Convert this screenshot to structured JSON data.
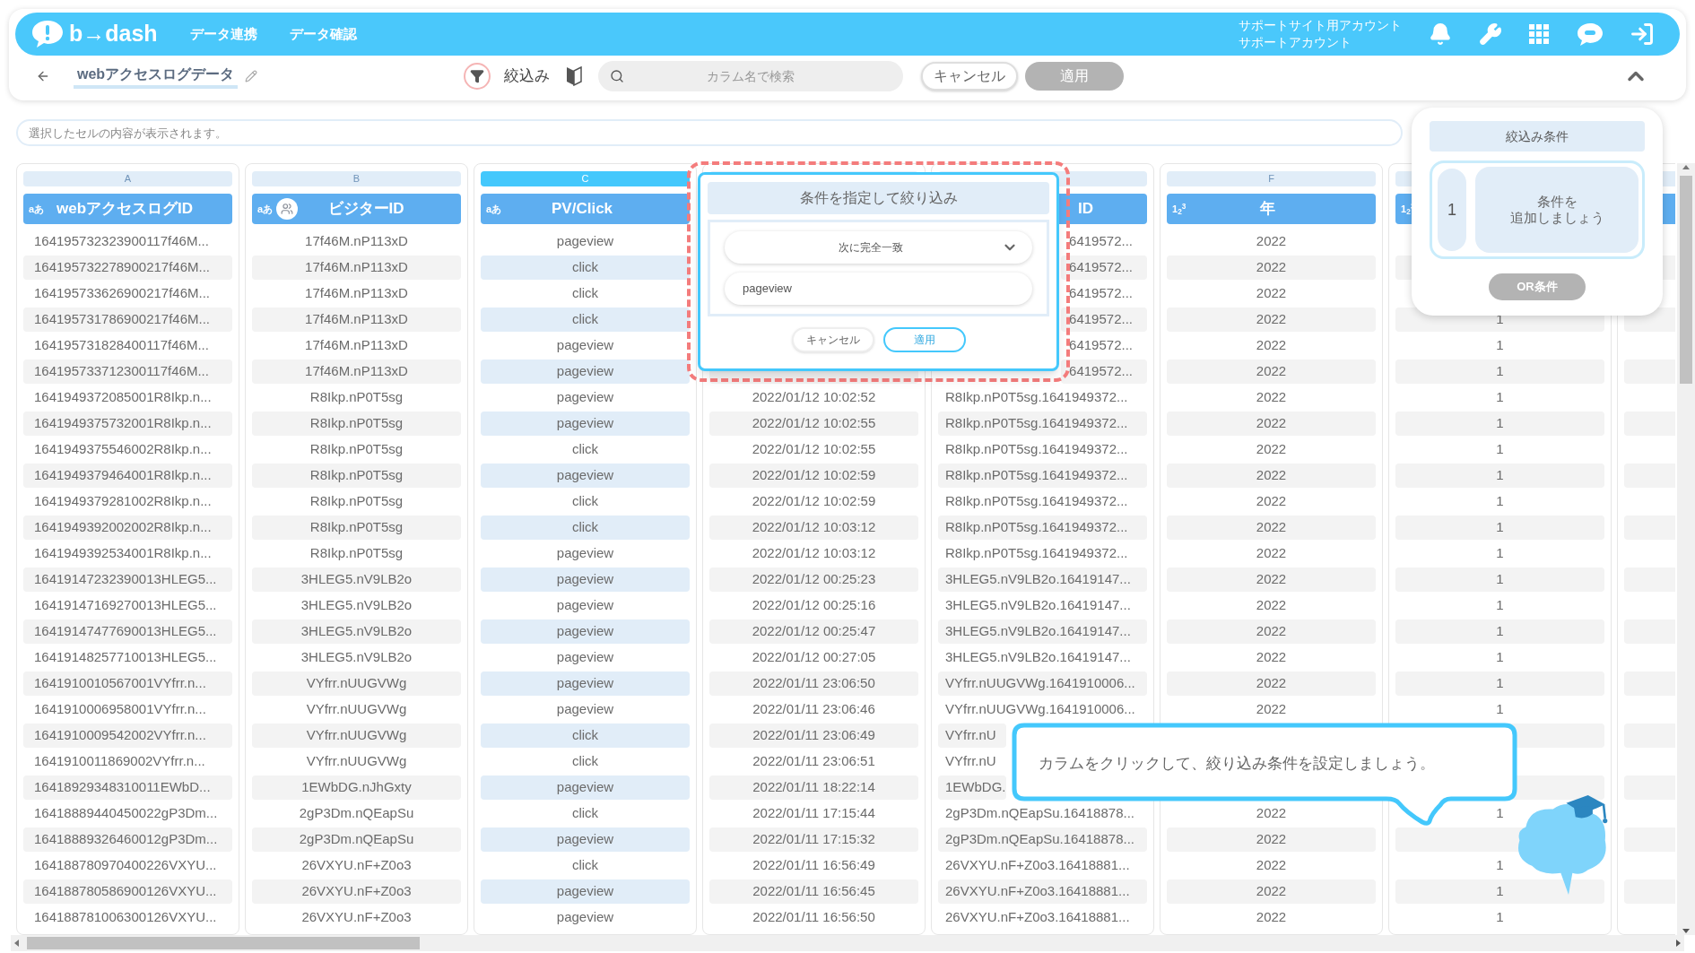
{
  "header": {
    "logo_text": "b→dash",
    "nav": [
      "データ連携",
      "データ確認"
    ],
    "account_lines": [
      "サポートサイト用アカウント",
      "サポートアカウント"
    ]
  },
  "toolbar": {
    "title": "webアクセスログデータ",
    "filter_label": "絞込み",
    "search": {
      "placeholder": "カラム名で検索"
    },
    "buttons": [
      {
        "label": "キャンセル",
        "kind": "secondary",
        "disabled": false
      },
      {
        "label": "適用",
        "kind": "primary",
        "disabled": true
      }
    ]
  },
  "formula_bar": {
    "placeholder": "選択したセルの内容が表示されます。"
  },
  "columns": [
    {
      "letter": "A",
      "type_badge": "aあ",
      "label": "webアクセスログID",
      "visitor": false,
      "selected": false,
      "cells": [
        "164195732323900117f46M...",
        "164195732278900217f46M...",
        "164195733626900217f46M...",
        "164195731786900217f46M...",
        "164195731828400117f46M...",
        "164195733712300117f46M...",
        "1641949372085001R8Ikp.n...",
        "1641949375732001R8Ikp.n...",
        "1641949375546002R8Ikp.n...",
        "1641949379464001R8Ikp.n...",
        "1641949379281002R8Ikp.n...",
        "1641949392002002R8Ikp.n...",
        "1641949392534001R8Ikp.n...",
        "16419147232390013HLEG5...",
        "16419147169270013HLEG5...",
        "16419147477690013HLEG5...",
        "16419148257710013HLEG5...",
        "1641910010567001VYfrr.n...",
        "1641910006958001VYfrr.n...",
        "1641910009542002VYfrr.n...",
        "1641910011869002VYfrr.n...",
        "16418929348310011EWbD...",
        "16418889440450022gP3Dm...",
        "16418889326460012gP3Dm...",
        "164188780970400226VXYU...",
        "164188780586900126VXYU...",
        "164188781006300126VXYU..."
      ]
    },
    {
      "letter": "B",
      "type_badge": "aあ",
      "label": "ビジターID",
      "visitor": true,
      "selected": false,
      "cells": [
        "17f46M.nP113xD",
        "17f46M.nP113xD",
        "17f46M.nP113xD",
        "17f46M.nP113xD",
        "17f46M.nP113xD",
        "17f46M.nP113xD",
        "R8Ikp.nP0T5sg",
        "R8Ikp.nP0T5sg",
        "R8Ikp.nP0T5sg",
        "R8Ikp.nP0T5sg",
        "R8Ikp.nP0T5sg",
        "R8Ikp.nP0T5sg",
        "R8Ikp.nP0T5sg",
        "3HLEG5.nV9LB2o",
        "3HLEG5.nV9LB2o",
        "3HLEG5.nV9LB2o",
        "3HLEG5.nV9LB2o",
        "VYfrr.nUUGVWg",
        "VYfrr.nUUGVWg",
        "VYfrr.nUUGVWg",
        "VYfrr.nUUGVWg",
        "1EWbDG.nJhGxty",
        "2gP3Dm.nQEapSu",
        "2gP3Dm.nQEapSu",
        "26VXYU.nF+Z0o3",
        "26VXYU.nF+Z0o3",
        "26VXYU.nF+Z0o3"
      ]
    },
    {
      "letter": "C",
      "type_badge": "aあ",
      "label": "PV/Click",
      "visitor": false,
      "selected": true,
      "cells": [
        "pageview",
        "click",
        "click",
        "click",
        "pageview",
        "pageview",
        "pageview",
        "pageview",
        "click",
        "pageview",
        "click",
        "click",
        "pageview",
        "pageview",
        "pageview",
        "pageview",
        "pageview",
        "pageview",
        "pageview",
        "click",
        "click",
        "pageview",
        "click",
        "pageview",
        "click",
        "pageview",
        "pageview"
      ]
    },
    {
      "selected": false,
      "cells": [
        null,
        null,
        null,
        null,
        null,
        null,
        "2022/01/12 10:02:52",
        "2022/01/12 10:02:55",
        "2022/01/12 10:02:55",
        "2022/01/12 10:02:59",
        "2022/01/12 10:02:59",
        "2022/01/12 10:03:12",
        "2022/01/12 10:03:12",
        "2022/01/12 00:25:23",
        "2022/01/12 00:25:16",
        "2022/01/12 00:25:47",
        "2022/01/12 00:27:05",
        "2022/01/11 23:06:50",
        "2022/01/11 23:06:46",
        "2022/01/11 23:06:49",
        "2022/01/11 23:06:51",
        "2022/01/11 18:22:14",
        "2022/01/11 17:15:44",
        "2022/01/11 17:15:32",
        "2022/01/11 16:56:49",
        "2022/01/11 16:56:45",
        "2022/01/11 16:56:50"
      ]
    },
    {
      "label": {
        "text": "ID",
        "kind": "tail"
      },
      "visitor": false,
      "selected": false,
      "cells": [
        {
          "text": "6419572...",
          "kind": "tail"
        },
        {
          "text": "6419572...",
          "kind": "tail"
        },
        {
          "text": "6419572...",
          "kind": "tail"
        },
        {
          "text": "6419572...",
          "kind": "tail"
        },
        {
          "text": "6419572...",
          "kind": "tail"
        },
        {
          "text": "6419572...",
          "kind": "tail"
        },
        "R8Ikp.nP0T5sg.1641949372...",
        "R8Ikp.nP0T5sg.1641949372...",
        "R8Ikp.nP0T5sg.1641949372...",
        "R8Ikp.nP0T5sg.1641949372...",
        "R8Ikp.nP0T5sg.1641949372...",
        "R8Ikp.nP0T5sg.1641949372...",
        "R8Ikp.nP0T5sg.1641949372...",
        "3HLEG5.nV9LB2o.16419147...",
        "3HLEG5.nV9LB2o.16419147...",
        "3HLEG5.nV9LB2o.16419147...",
        "3HLEG5.nV9LB2o.16419147...",
        "VYfrr.nUUGVWg.1641910006...",
        "VYfrr.nUUGVWg.1641910006...",
        {
          "text": "VYfrr.nU",
          "kind": "head"
        },
        {
          "text": "VYfrr.nU",
          "kind": "head"
        },
        {
          "text": "1EWbDG.",
          "kind": "head"
        },
        "2gP3Dm.nQEapSu.16418878...",
        "2gP3Dm.nQEapSu.16418878...",
        "26VXYU.nF+Z0o3.16418881...",
        "26VXYU.nF+Z0o3.16418881...",
        "26VXYU.nF+Z0o3.16418881..."
      ]
    },
    {
      "letter": "F",
      "type_badge": "1$_{2}$$^{3}$",
      "label": "年",
      "visitor": false,
      "selected": false,
      "cells": [
        "2022",
        "2022",
        "2022",
        "2022",
        "2022",
        "2022",
        "2022",
        "2022",
        "2022",
        "2022",
        "2022",
        "2022",
        "2022",
        "2022",
        "2022",
        "2022",
        "2022",
        "2022",
        "2022",
        null,
        null,
        null,
        "2022",
        "2022",
        "2022",
        "2022",
        "2022"
      ]
    },
    {
      "type_badge": "1$_{2}$$^{3}$",
      "selected": false,
      "cells": [
        null,
        null,
        null,
        "1",
        "1",
        "1",
        "1",
        "1",
        "1",
        "1",
        "1",
        "1",
        "1",
        "1",
        "1",
        "1",
        "1",
        "1",
        "1",
        null,
        null,
        null,
        "1",
        null,
        "1",
        "1",
        "1"
      ]
    }
  ],
  "filter_popup": {
    "title": "条件を指定して絞り込み",
    "condition": "次に完全一致",
    "value": "pageview",
    "buttons": [
      {
        "label": "キャンセル",
        "kind": "secondary"
      },
      {
        "label": "適用",
        "kind": "primary"
      }
    ]
  },
  "filter_panel": {
    "title": "絞込み条件",
    "group_number": "1",
    "hint_lines": [
      "条件を",
      "追加しましょう"
    ],
    "or_button": {
      "label": "OR条件",
      "disabled": true
    }
  },
  "tip": {
    "text": "カラムをクリックして、絞り込み条件を設定しましょう。"
  }
}
